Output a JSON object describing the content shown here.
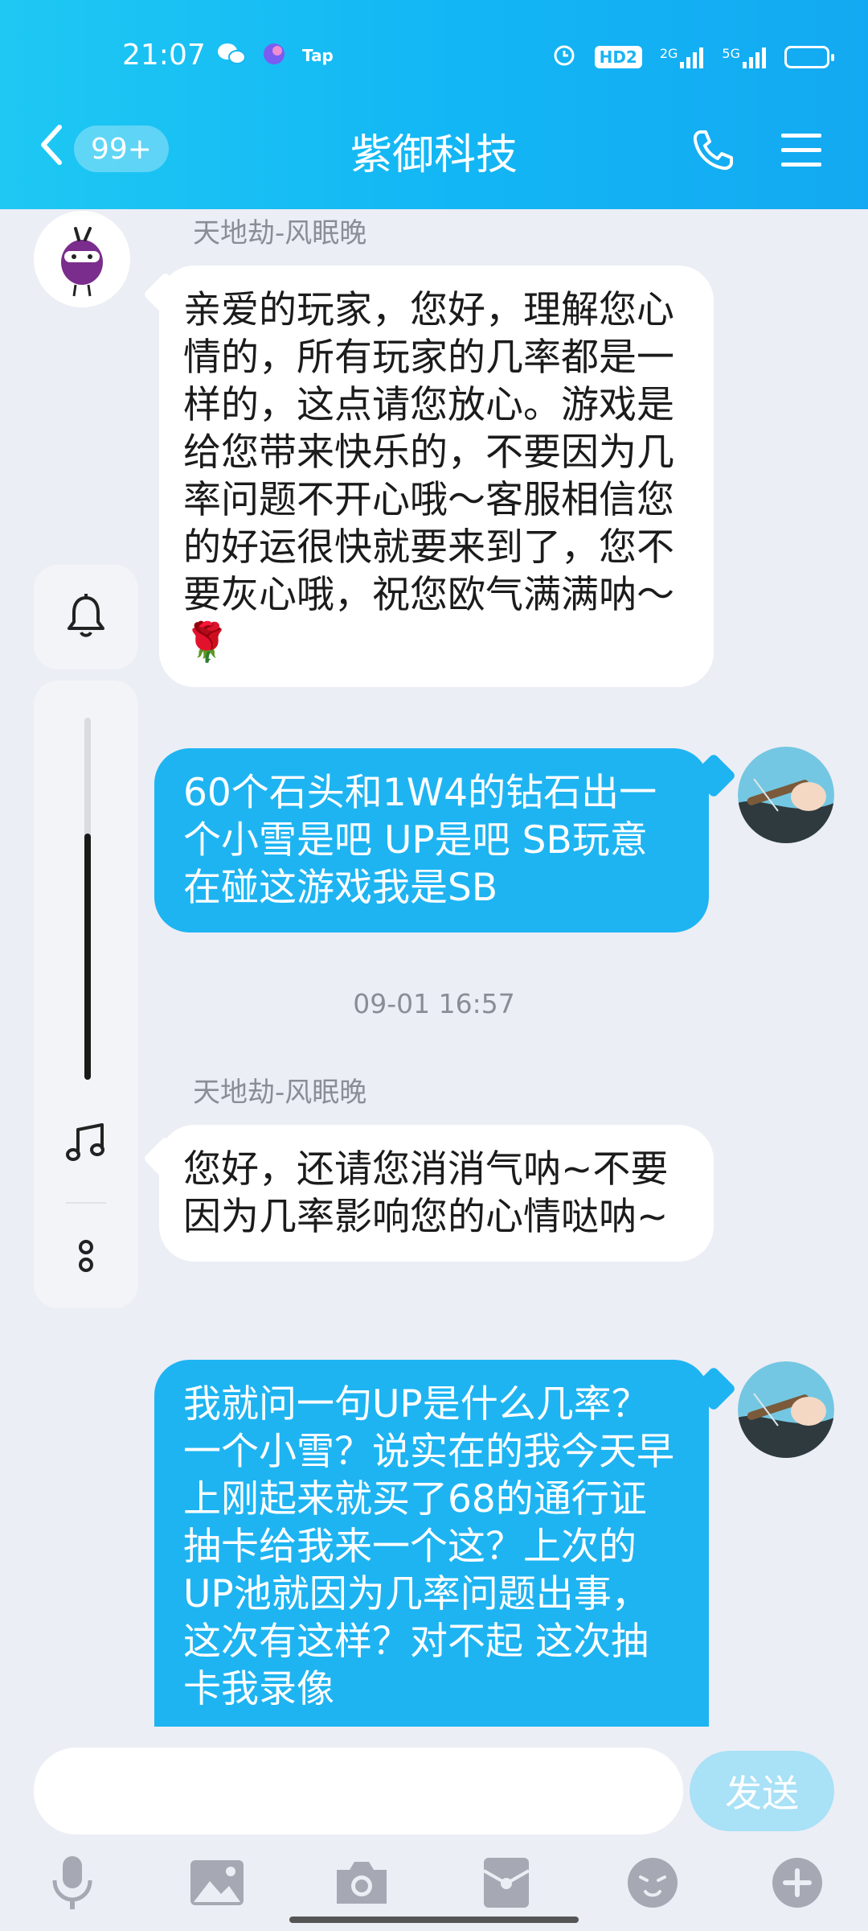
{
  "status_bar": {
    "time": "21:07",
    "left_icons": [
      "wechat-icon",
      "app-icon",
      "tap-icon"
    ],
    "tap_label": "Tap",
    "right_icons": [
      "alarm-icon",
      "hd-icon",
      "signal-2g-icon",
      "signal-5g-icon",
      "battery-icon"
    ],
    "hd_label": "HD2",
    "net1": "2G",
    "net2": "5G"
  },
  "header": {
    "unread_badge": "99+",
    "title": "紫御科技"
  },
  "messages": [
    {
      "direction": "incoming",
      "sender": "天地劫-风眠晚",
      "text": "亲爱的玩家，您好，理解您心情的，所有玩家的几率都是一样的，这点请您放心。游戏是给您带来快乐的，不要因为几率问题不开心哦～客服相信您的好运很快就要来到了，您不要灰心哦，祝您欧气满满呐～🌹"
    },
    {
      "direction": "outgoing",
      "text": "60个石头和1W4的钻石出一个小雪是吧 UP是吧 SB玩意在碰这游戏我是SB"
    },
    {
      "direction": "timestamp",
      "text": "09-01 16:57"
    },
    {
      "direction": "incoming",
      "sender": "天地劫-风眠晚",
      "text": "您好，还请您消消气呐~不要因为几率影响您的心情哒呐~"
    },
    {
      "direction": "outgoing",
      "text": "我就问一句UP是什么几率？一个小雪？说实在的我今天早上刚起来就买了68的通行证 抽卡给我来一个这？上次的UP池就因为几率问题出事，这次有这样？对不起 这次抽卡我录像"
    }
  ],
  "volume_panel": {
    "level": 0.68,
    "icons": [
      "bell-icon",
      "music-note-icon",
      "more-icon"
    ]
  },
  "input": {
    "placeholder": "",
    "send_label": "发送"
  },
  "toolbar": {
    "icons": [
      "microphone-icon",
      "image-icon",
      "camera-icon",
      "red-packet-icon",
      "emoji-icon",
      "plus-icon"
    ]
  },
  "colors": {
    "header": "#16b4f3",
    "outgoing_bubble": "#1eb4f2",
    "incoming_bubble": "#ffffff",
    "background": "#eceef5"
  }
}
